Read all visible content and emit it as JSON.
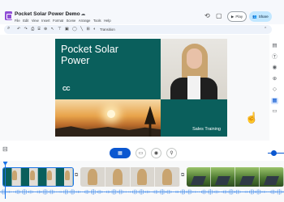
{
  "header": {
    "title": "Pocket Solar Power Demo",
    "title_icons": [
      "star-icon",
      "folder-icon",
      "cloud-icon"
    ],
    "menu": [
      "File",
      "Edit",
      "View",
      "Insert",
      "Format",
      "Scene",
      "Arrange",
      "Tools",
      "Help"
    ],
    "history_icon": "history-icon",
    "comment_icon": "comment-icon",
    "play_label": "Play",
    "share_label": "Share"
  },
  "toolbar": {
    "icons": [
      "search-icon",
      "undo-icon",
      "redo-icon",
      "print-icon",
      "paint-format-icon",
      "zoom-icon",
      "cursor-icon",
      "text-box-icon",
      "image-icon",
      "shape-icon",
      "line-icon",
      "comment-add-icon",
      "background-icon"
    ],
    "transition_label": "Transition"
  },
  "slide": {
    "title_line1": "Pocket Solar",
    "title_line2": "Power",
    "logo_text": "CC",
    "subtitle": "Sales Training"
  },
  "side_panel": {
    "icons": [
      "scenes-icon",
      "text-icon",
      "record-icon",
      "media-icon",
      "shapes-icon",
      "slides-icon",
      "layout-icon"
    ]
  },
  "view_toolbar": {
    "buttons": [
      "grid-view-icon",
      "scene-view-icon",
      "record-icon",
      "add-person-icon"
    ],
    "zoom_level": 0.2
  },
  "timeline": {
    "clips": [
      {
        "type": "slide",
        "thumbs": 4,
        "selected": true
      },
      {
        "type": "woman",
        "thumbs": 4,
        "selected": false
      },
      {
        "type": "forest",
        "thumbs": 4,
        "selected": false
      }
    ]
  },
  "colors": {
    "accent": "#0b57d0",
    "slide_teal": "#0a5f5c",
    "share_bg": "#c2e7ff",
    "app_icon": "#8e4dd6"
  }
}
